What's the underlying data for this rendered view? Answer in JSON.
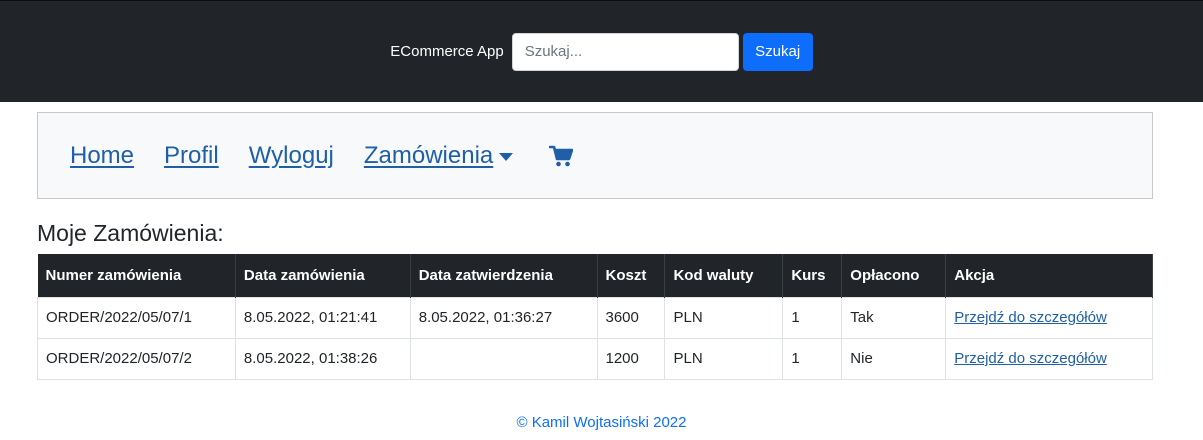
{
  "header": {
    "brand": "ECommerce App",
    "search_placeholder": "Szukaj...",
    "search_button": "Szukaj"
  },
  "nav": {
    "home": "Home",
    "profile": "Profil",
    "logout": "Wyloguj",
    "orders": "Zamówienia",
    "cart_icon": "shopping-cart-icon"
  },
  "page": {
    "heading": "Moje Zamówienia:"
  },
  "table": {
    "columns": [
      "Numer zamówienia",
      "Data zamówienia",
      "Data zatwierdzenia",
      "Koszt",
      "Kod waluty",
      "Kurs",
      "Opłacono",
      "Akcja"
    ],
    "rows": [
      [
        "ORDER/2022/05/07/1",
        "8.05.2022, 01:21:41",
        "8.05.2022, 01:36:27",
        "3600",
        "PLN",
        "1",
        "Tak",
        "Przejdź do szczegółów"
      ],
      [
        "ORDER/2022/05/07/2",
        "8.05.2022, 01:38:26",
        "",
        "1200",
        "PLN",
        "1",
        "Nie",
        "Przejdź do szczegółów"
      ]
    ]
  },
  "footer": {
    "text": "© Kamil Wojtasiński 2022"
  },
  "colors": {
    "topbar": "#212529",
    "primary": "#0d6efd",
    "link": "#1e5fa8",
    "nav_background": "#f8f9fa"
  }
}
